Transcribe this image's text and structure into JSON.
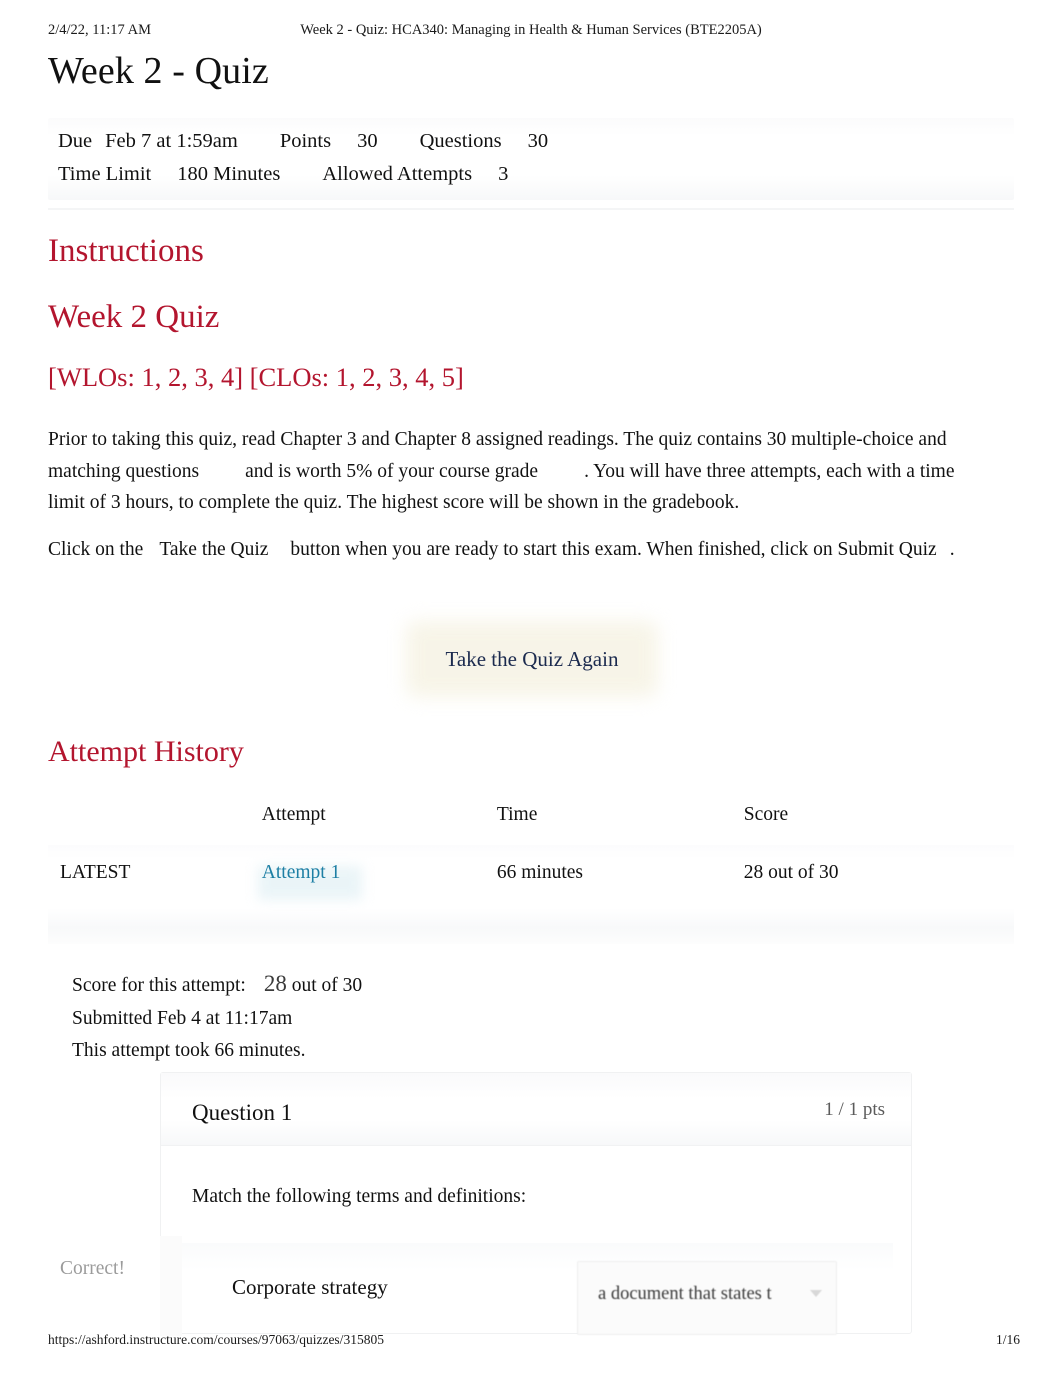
{
  "print_header": {
    "timestamp": "2/4/22, 11:17 AM",
    "doc_title": "Week 2 - Quiz: HCA340: Managing in Health & Human Services (BTE2205A)"
  },
  "print_footer": {
    "url": "https://ashford.instructure.com/courses/97063/quizzes/315805",
    "page": "1/16"
  },
  "page": {
    "title": "Week 2 - Quiz"
  },
  "details": {
    "due_label": "Due",
    "due_value": "Feb 7 at 1:59am",
    "points_label": "Points",
    "points_value": "30",
    "questions_label": "Questions",
    "questions_value": "30",
    "time_limit_label": "Time Limit",
    "time_limit_value": "180 Minutes",
    "allowed_attempts_label": "Allowed Attempts",
    "allowed_attempts_value": "3"
  },
  "instructions": {
    "heading": "Instructions",
    "subheading": "Week 2 Quiz",
    "outcomes": "[WLOs: 1, 2, 3, 4] [CLOs: 1, 2, 3, 4, 5]",
    "paragraph1_a": "Prior to taking this quiz, read Chapter 3 and Chapter 8 assigned readings. The quiz contains 30 multiple-choice and matching questions",
    "paragraph1_b": "and is worth 5% of your course grade",
    "paragraph1_c": ". You will have three attempts, each with a time limit of 3 hours, to complete the quiz. The highest score will be shown in the gradebook.",
    "paragraph2_a": "Click on the",
    "paragraph2_b": "Take the Quiz",
    "paragraph2_c": "button when you are ready to start this exam. When finished, click on",
    "paragraph2_d": "Submit Quiz",
    "paragraph2_e": "."
  },
  "retake": {
    "label": "Take the Quiz Again"
  },
  "attempt_history": {
    "heading": "Attempt History",
    "columns": [
      "",
      "Attempt",
      "Time",
      "Score"
    ],
    "rows": [
      {
        "flag": "LATEST",
        "attempt": "Attempt 1",
        "time": "66 minutes",
        "score": "28 out of 30"
      }
    ]
  },
  "score_summary": {
    "score_label": "Score for this attempt:",
    "score_value": "28",
    "score_outof": "out of 30",
    "submitted": "Submitted Feb 4 at 11:17am",
    "duration": "This attempt took 66 minutes."
  },
  "question": {
    "title": "Question 1",
    "points": "1 / 1 pts",
    "prompt": "Match the following terms and definitions:",
    "correct_flag": "Correct!",
    "term": "Corporate strategy",
    "selected_answer": "a document that states t"
  },
  "colors": {
    "heading_red": "#B3152E",
    "link_teal": "#1D7FA4",
    "button_navy": "#1B2A4E",
    "muted_gray": "#9B9B9B",
    "body_black": "#111111"
  }
}
